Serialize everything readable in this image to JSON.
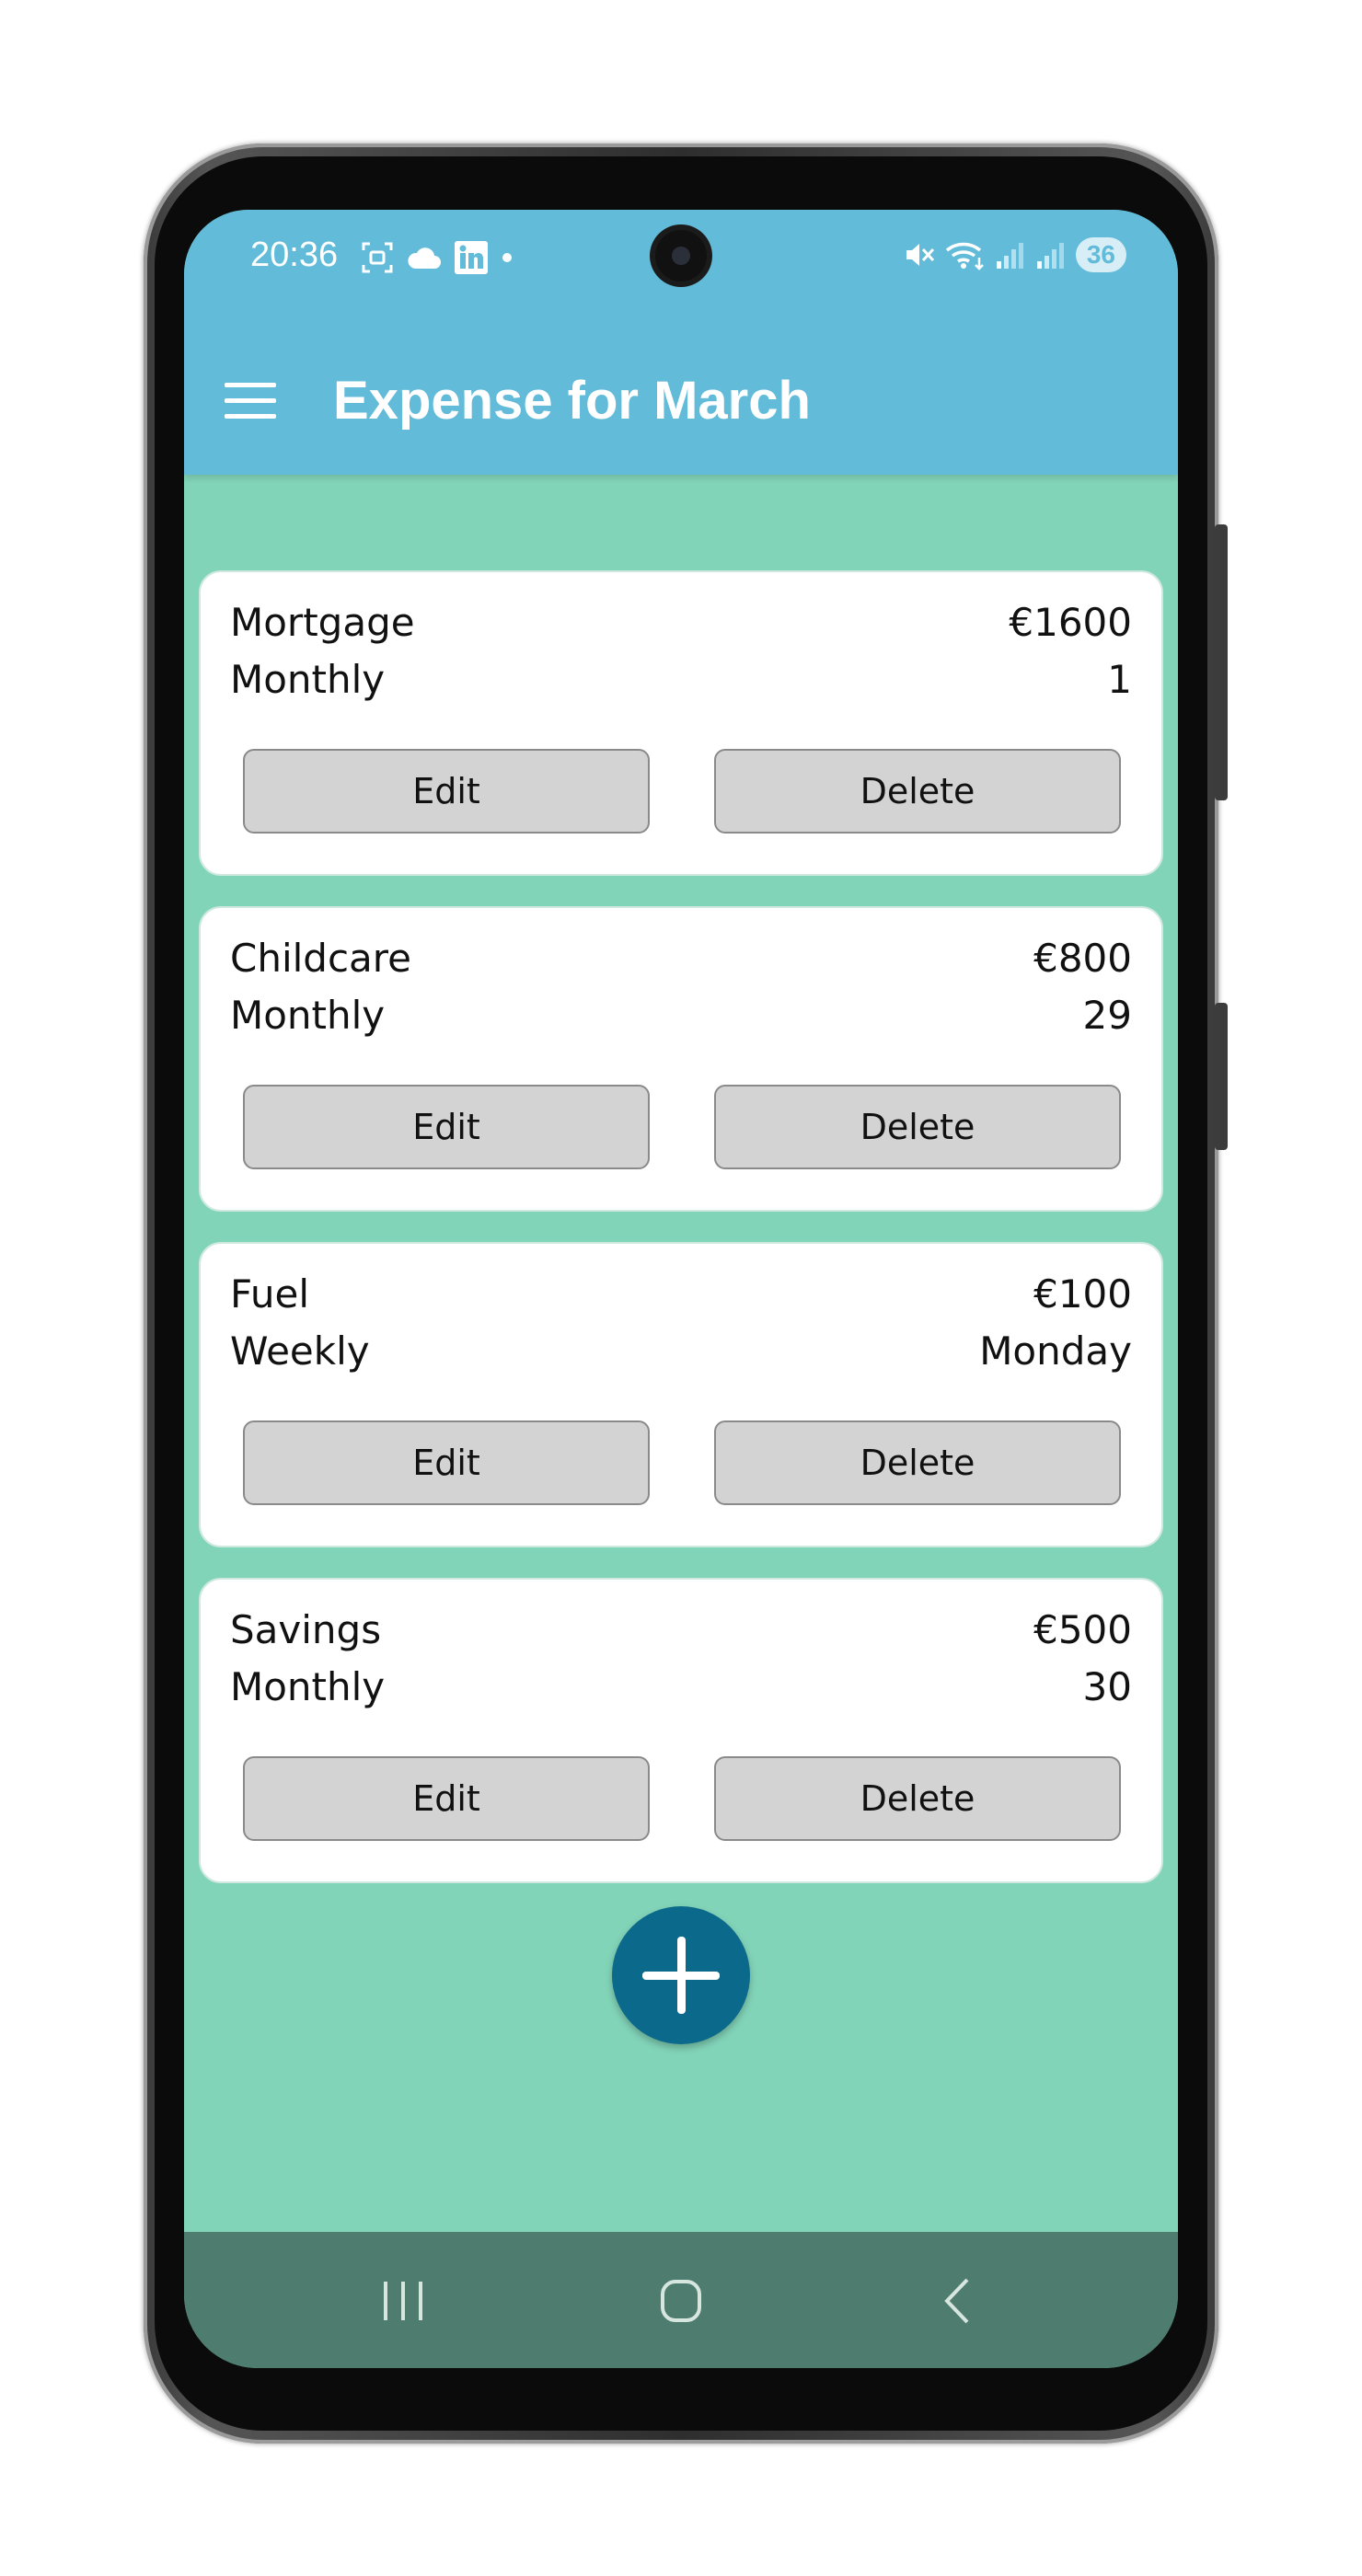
{
  "status_bar": {
    "time": "20:36",
    "battery": "36",
    "left_icons": [
      "screenshot-icon",
      "cloud-icon",
      "linkedin-icon",
      "dot-icon"
    ],
    "right_icons": [
      "mute-icon",
      "wifi-icon",
      "signal-icon",
      "signal-icon"
    ]
  },
  "app_bar": {
    "title": "Expense for March",
    "menu_icon": "hamburger-menu-icon"
  },
  "expenses": [
    {
      "name": "Mortgage",
      "amount": "€1600",
      "frequency": "Monthly",
      "due": "1",
      "edit_label": "Edit",
      "delete_label": "Delete"
    },
    {
      "name": "Childcare",
      "amount": "€800",
      "frequency": "Monthly",
      "due": "29",
      "edit_label": "Edit",
      "delete_label": "Delete"
    },
    {
      "name": "Fuel",
      "amount": "€100",
      "frequency": "Weekly",
      "due": "Monday",
      "edit_label": "Edit",
      "delete_label": "Delete"
    },
    {
      "name": "Savings",
      "amount": "€500",
      "frequency": "Monthly",
      "due": "30",
      "edit_label": "Edit",
      "delete_label": "Delete"
    }
  ],
  "fab": {
    "icon": "plus-icon"
  },
  "nav_bar": {
    "icons": [
      "recent-apps-icon",
      "home-icon",
      "back-icon"
    ]
  },
  "colors": {
    "app_bar": "#62bcd9",
    "background": "#82d4b9",
    "card": "#ffffff",
    "button": "#d3d3d3",
    "fab": "#0b6a8c",
    "nav_bar": "#4e7c6e"
  }
}
